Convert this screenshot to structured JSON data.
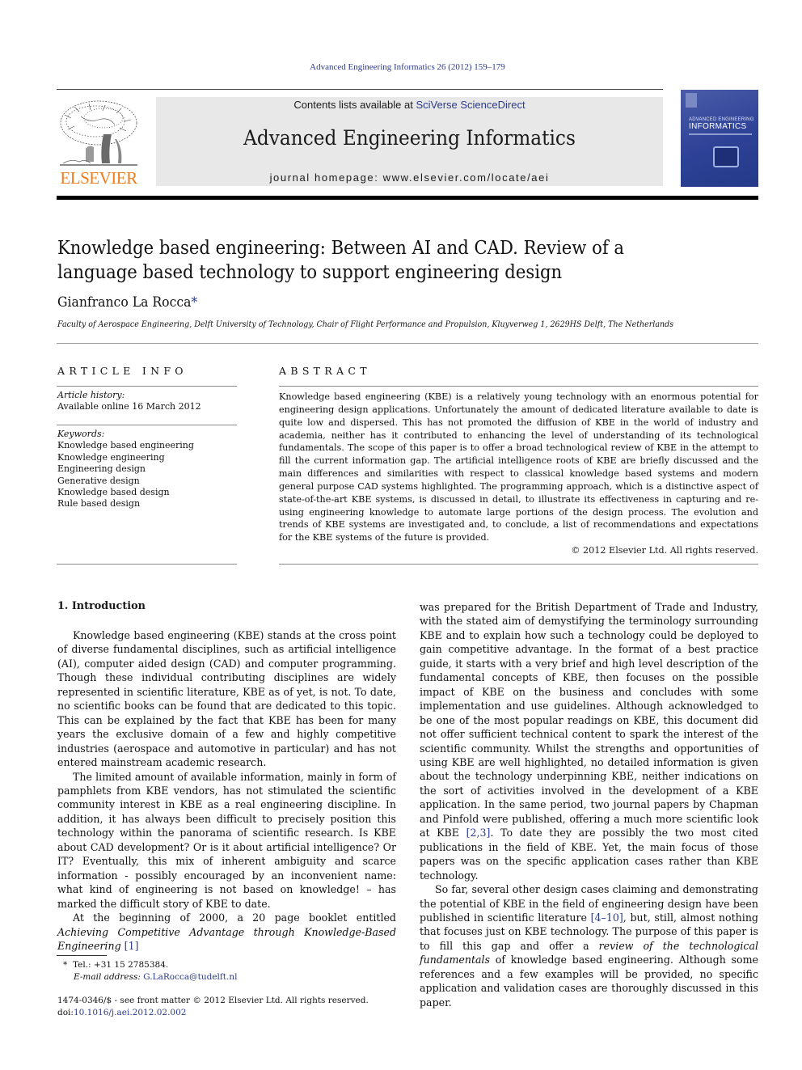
{
  "header": {
    "journal_citation": "Advanced Engineering Informatics 26 (2012) 159–179",
    "contents_prefix": "Contents lists available at ",
    "contents_link": "SciVerse ScienceDirect",
    "journal_title": "Advanced Engineering Informatics",
    "homepage_label": "journal homepage: www.elsevier.com/locate/aei",
    "publisher_logo_text": "ELSEVIER",
    "cover": {
      "subtitle": "ADVANCED ENGINEERING",
      "title": "INFORMATICS"
    }
  },
  "article": {
    "title": "Knowledge based engineering: Between AI and CAD. Review of a language based technology to support engineering design",
    "author": "Gianfranco La Rocca",
    "author_mark": "*",
    "affiliation": "Faculty of Aerospace Engineering, Delft University of Technology, Chair of Flight Performance and Propulsion, Kluyverweg 1, 2629HS Delft, The Netherlands"
  },
  "article_info": {
    "heading": "ARTICLE INFO",
    "history_label": "Article history:",
    "history_value": "Available online 16 March 2012",
    "keywords_label": "Keywords:",
    "keywords": [
      "Knowledge based engineering",
      "Knowledge engineering",
      "Engineering design",
      "Generative design",
      "Knowledge based design",
      "Rule based design"
    ]
  },
  "abstract": {
    "heading": "ABSTRACT",
    "text": "Knowledge based engineering (KBE) is a relatively young technology with an enormous potential for engineering design applications. Unfortunately the amount of dedicated literature available to date is quite low and dispersed. This has not promoted the diffusion of KBE in the world of industry and academia, neither has it contributed to enhancing the level of understanding of its technological fundamentals. The scope of this paper is to offer a broad technological review of KBE in the attempt to fill the current information gap. The artificial intelligence roots of KBE are briefly discussed and the main differences and similarities with respect to classical knowledge based systems and modern general purpose CAD systems highlighted. The programming approach, which is a distinctive aspect of state-of-the-art KBE systems, is discussed in detail, to illustrate its effectiveness in capturing and re-using engineering knowledge to automate large portions of the design process. The evolution and trends of KBE systems are investigated and, to conclude, a list of recommendations and expectations for the KBE systems of the future is provided.",
    "copyright": "© 2012 Elsevier Ltd. All rights reserved."
  },
  "body": {
    "section_heading": "1. Introduction",
    "p1": "Knowledge based engineering (KBE) stands at the cross point of diverse fundamental disciplines, such as artificial intelligence (AI), computer aided design (CAD) and computer programming. Though these individual contributing disciplines are widely represented in scientific literature, KBE as of yet, is not. To date, no scientific books can be found that are dedicated to this topic. This can be explained by the fact that KBE has been for many years the exclusive domain of a few and highly competitive industries (aerospace and automo­tive in particular) and has not entered mainstream academic research.",
    "p2": "The limited amount of available information, mainly in form of pamphlets from KBE vendors, has not stimulated the scientific com­munity interest in KBE as a real engineering discipline. In addition, it has always been difficult to precisely position this technology with­in the panorama of scientific research. Is KBE about CAD develop­ment? Or is it about artificial intelligence? Or IT? Eventually, this mix of inherent ambiguity and scarce information - possibly encouraged by an inconvenient name: what kind of engineering is not based on knowledge! – has marked the difficult story of KBE to date.",
    "p3_pre": "At the beginning of 2000, a 20 page booklet entitled ",
    "p3_italic": "Achieving Competitive Advantage through Knowledge-Based Engineering",
    "p3_ref": "[1]",
    "p3_cont": "was prepared for the British Department of Trade and Industry, with the stated aim of demystifying the terminology surrounding KBE and to explain how such a technology could be deployed to gain competitive advantage. In the format of a best practice guide, it starts with a very brief and high level description of the funda­mental concepts of KBE, then focuses on the possible impact of KBE on the business and concludes with some implementation and use guidelines. Although acknowledged to be one of the most popular readings on KBE, this document did not offer sufficient technical content to spark the interest of the scientific community. Whilst the strengths and opportunities of using KBE are well highlighted, no detailed information is given about the technology underpinning KBE, neither indications on the sort of activities in­volved in the development of a KBE application. In the same period, two journal papers by Chapman and Pinfold were published, offering a much more scientific look at KBE ",
    "p3_ref2": "[2,3]",
    "p3_end": ". To date they are possibly the two most cited publications in the field of KBE. Yet, the main focus of those papers was on the specific application cases rather than KBE technology.",
    "p4_pre": "So far, several other design cases claiming and demonstrating the potential of KBE in the field of engineering design have been published in scientific literature ",
    "p4_ref": "[4–10]",
    "p4_mid": ", but, still, almost nothing that focuses just on KBE technology. The purpose of this paper is to fill this gap and offer a ",
    "p4_italic": "review of the technological fundamentals",
    "p4_end": " of knowledge based engineering. Although some references and a few examples will be provided, no specific application and valida­tion cases are thoroughly discussed in this paper."
  },
  "footnote": {
    "mark": "*",
    "tel": "Tel.: +31 15 2785384.",
    "email_label": "E-mail address: ",
    "email": "G.LaRocca@tudelft.nl"
  },
  "front_matter": {
    "issn_line": "1474-0346/$ - see front matter © 2012 Elsevier Ltd. All rights reserved.",
    "doi_label": "doi:",
    "doi": "10.1016/j.aei.2012.02.002"
  }
}
